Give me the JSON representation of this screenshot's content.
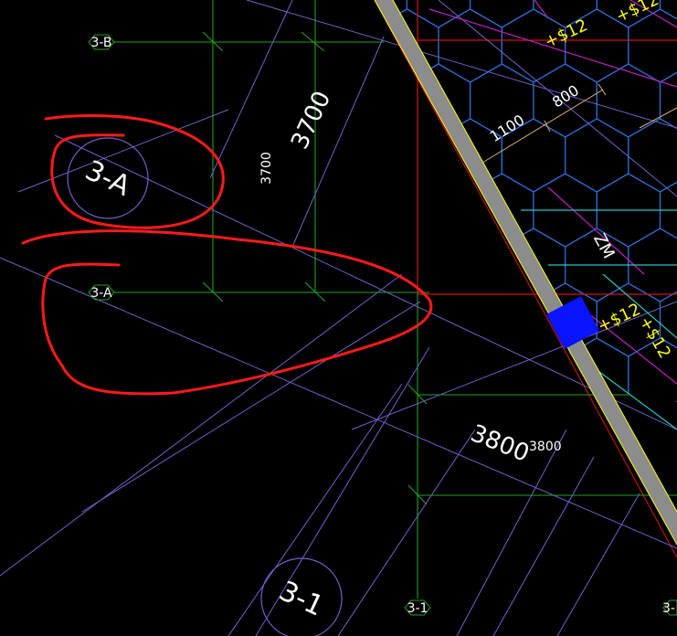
{
  "labels": {
    "axis_3b": "3-B",
    "axis_3a": "3-A",
    "axis_31": "3-1",
    "axis_3_partial": "3-",
    "bubble_3a": "3-A",
    "bubble_31": "3-1"
  },
  "dimensions": {
    "dim_3700_rotated": "3700",
    "dim_3700_vertical": "3700",
    "dim_3800_rotated": "3800",
    "dim_3800_horizontal": "3800",
    "dim_1100": "1100",
    "dim_800": "800"
  },
  "annotations": {
    "rebar_top": "+$12",
    "rebar_top2": "+$12",
    "rebar_mid1": "+$12",
    "rebar_mid2": "+$12",
    "column_tag": "ZM"
  },
  "colors": {
    "background": "#000000",
    "grid_green": "#1fa31f",
    "grid_purple": "#6f62c9",
    "wall_gray": "#8c8c8c",
    "wall_edge": "#ffff00",
    "red_line": "#d41414",
    "blue_hex": "#2a6fd6",
    "magenta": "#c020c0",
    "cyan": "#22c8c8",
    "dim_orange": "#e0b070",
    "column_blue": "#0a14ff",
    "markup_red": "#ff1a1a"
  }
}
